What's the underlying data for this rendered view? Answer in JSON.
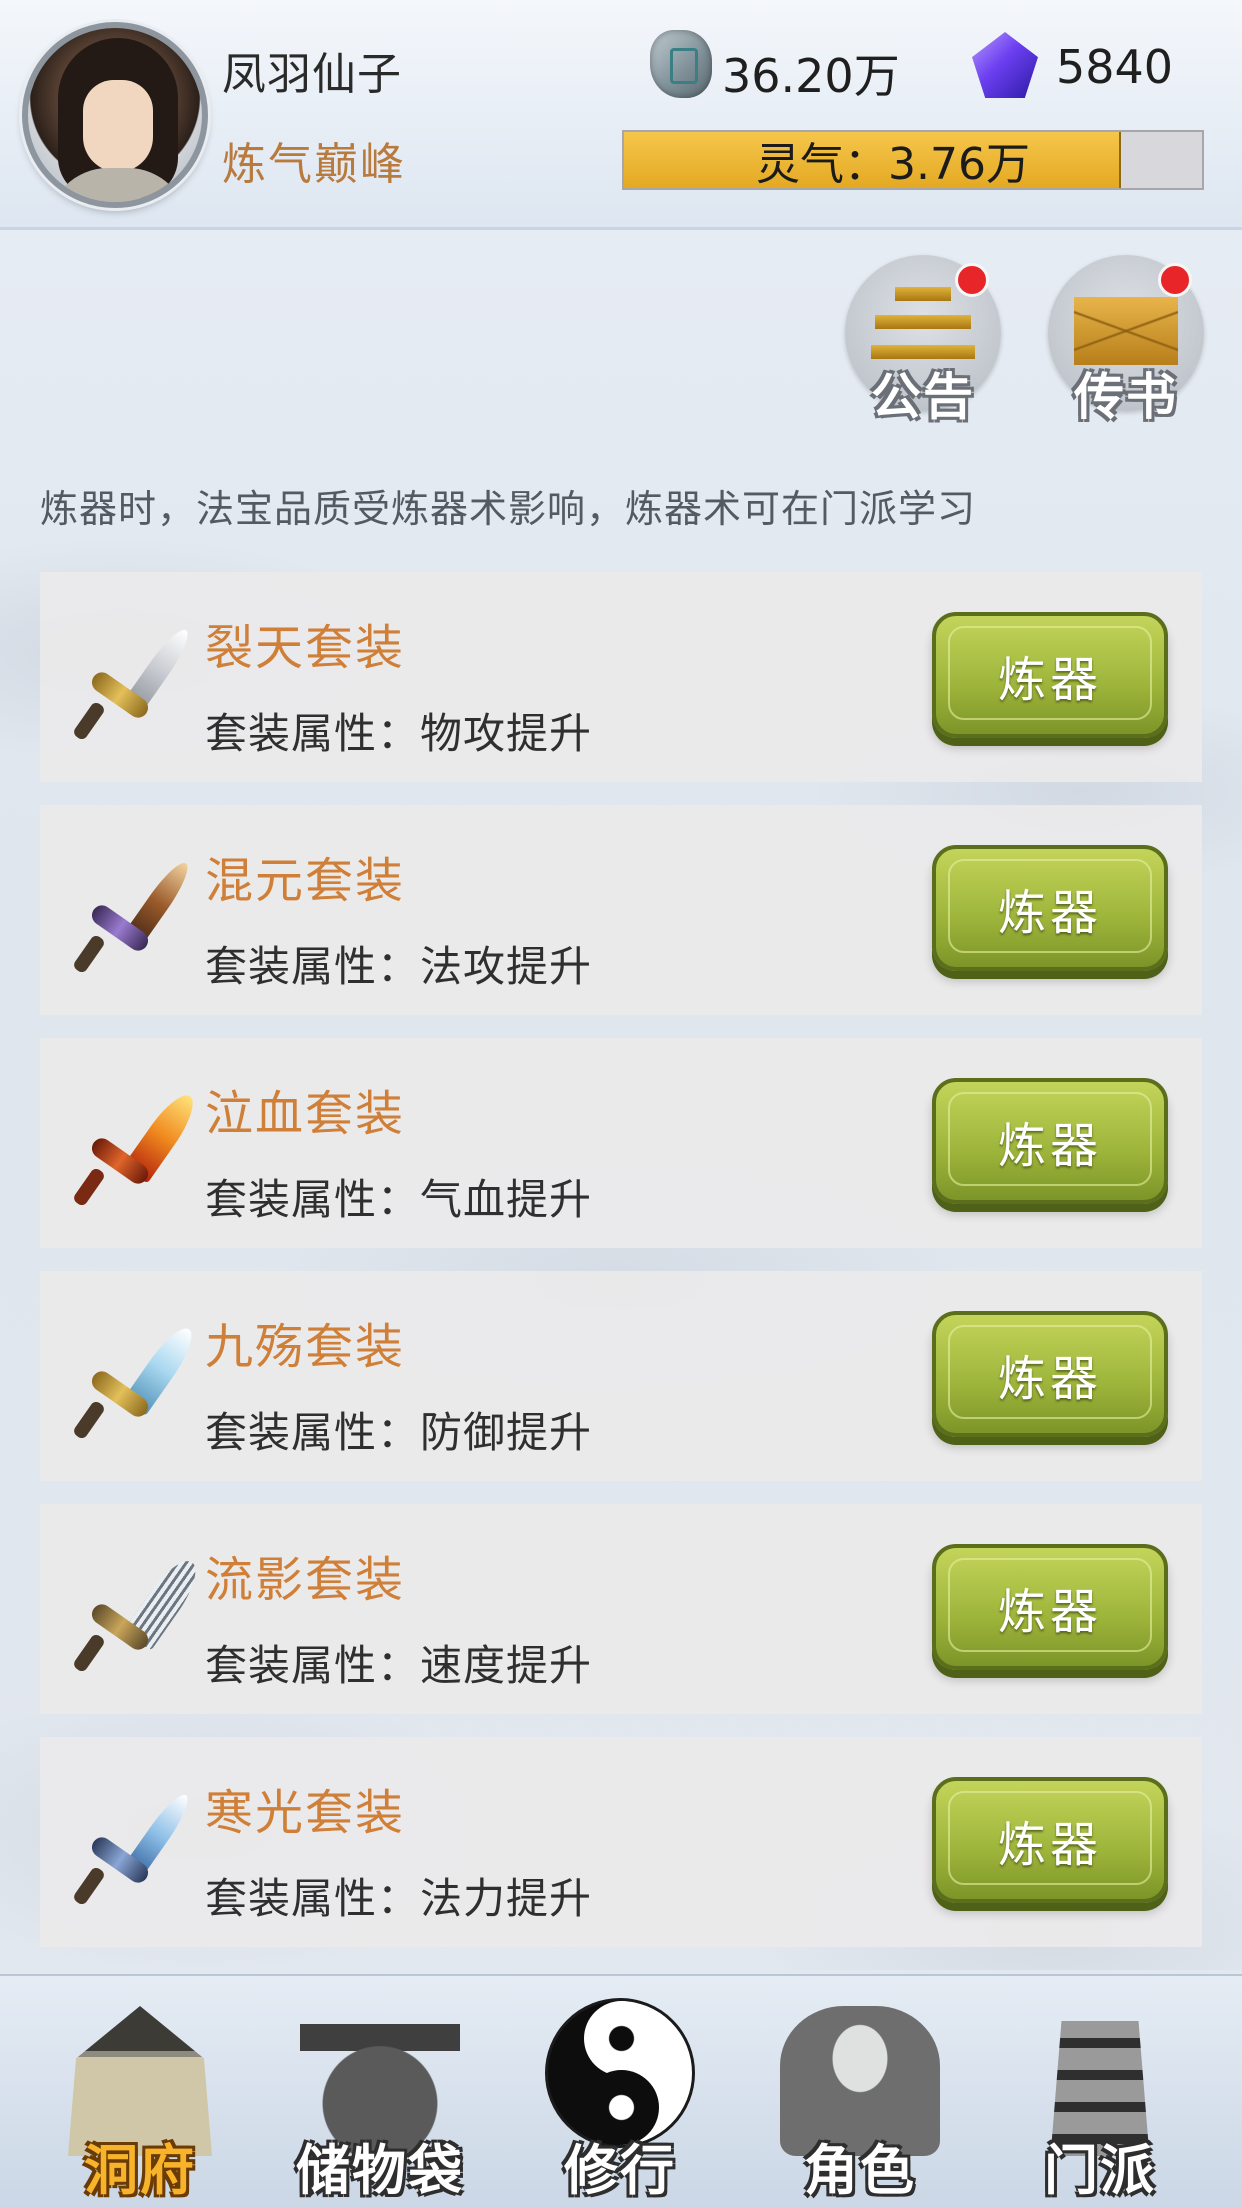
{
  "header": {
    "player_name": "凤羽仙子",
    "rank": "炼气巅峰",
    "spirit_stone": {
      "icon": "spirit-stone-icon",
      "value": "36.20万"
    },
    "gem": {
      "icon": "purple-gem-icon",
      "value": "5840"
    },
    "qi": {
      "label": "灵气：3.76万",
      "progress_fraction": 0.86
    }
  },
  "quick_buttons": [
    {
      "label": "公告",
      "icon": "notice-icon",
      "has_notification": true
    },
    {
      "label": "传书",
      "icon": "mail-icon",
      "has_notification": true
    }
  ],
  "hint": "炼器时，法宝品质受炼器术影响，炼器术可在门派学习",
  "recipes": [
    {
      "name": "裂天套装",
      "attr": "套装属性：物攻提升",
      "button": "炼器",
      "icon": "sword-icon"
    },
    {
      "name": "混元套装",
      "attr": "套装属性：法攻提升",
      "button": "炼器",
      "icon": "sword-icon"
    },
    {
      "name": "泣血套装",
      "attr": "套装属性：气血提升",
      "button": "炼器",
      "icon": "flame-sword-icon"
    },
    {
      "name": "九殇套装",
      "attr": "套装属性：防御提升",
      "button": "炼器",
      "icon": "ice-sword-icon"
    },
    {
      "name": "流影套装",
      "attr": "套装属性：速度提升",
      "button": "炼器",
      "icon": "feather-fan-icon"
    },
    {
      "name": "寒光套装",
      "attr": "套装属性：法力提升",
      "button": "炼器",
      "icon": "frost-sword-icon"
    }
  ],
  "nav": [
    {
      "label": "洞府",
      "icon": "house-icon",
      "active": true
    },
    {
      "label": "储物袋",
      "icon": "bag-icon",
      "active": false
    },
    {
      "label": "修行",
      "icon": "yinyang-icon",
      "active": false
    },
    {
      "label": "角色",
      "icon": "hooded-figure-icon",
      "active": false
    },
    {
      "label": "门派",
      "icon": "tower-icon",
      "active": false
    }
  ],
  "colors": {
    "recipe_name": "#cf7f37",
    "forge_button": "#9cb43a",
    "active_nav": "#f7b32a",
    "notification_dot": "#e8262a",
    "qi_fill": "#e4a924"
  }
}
